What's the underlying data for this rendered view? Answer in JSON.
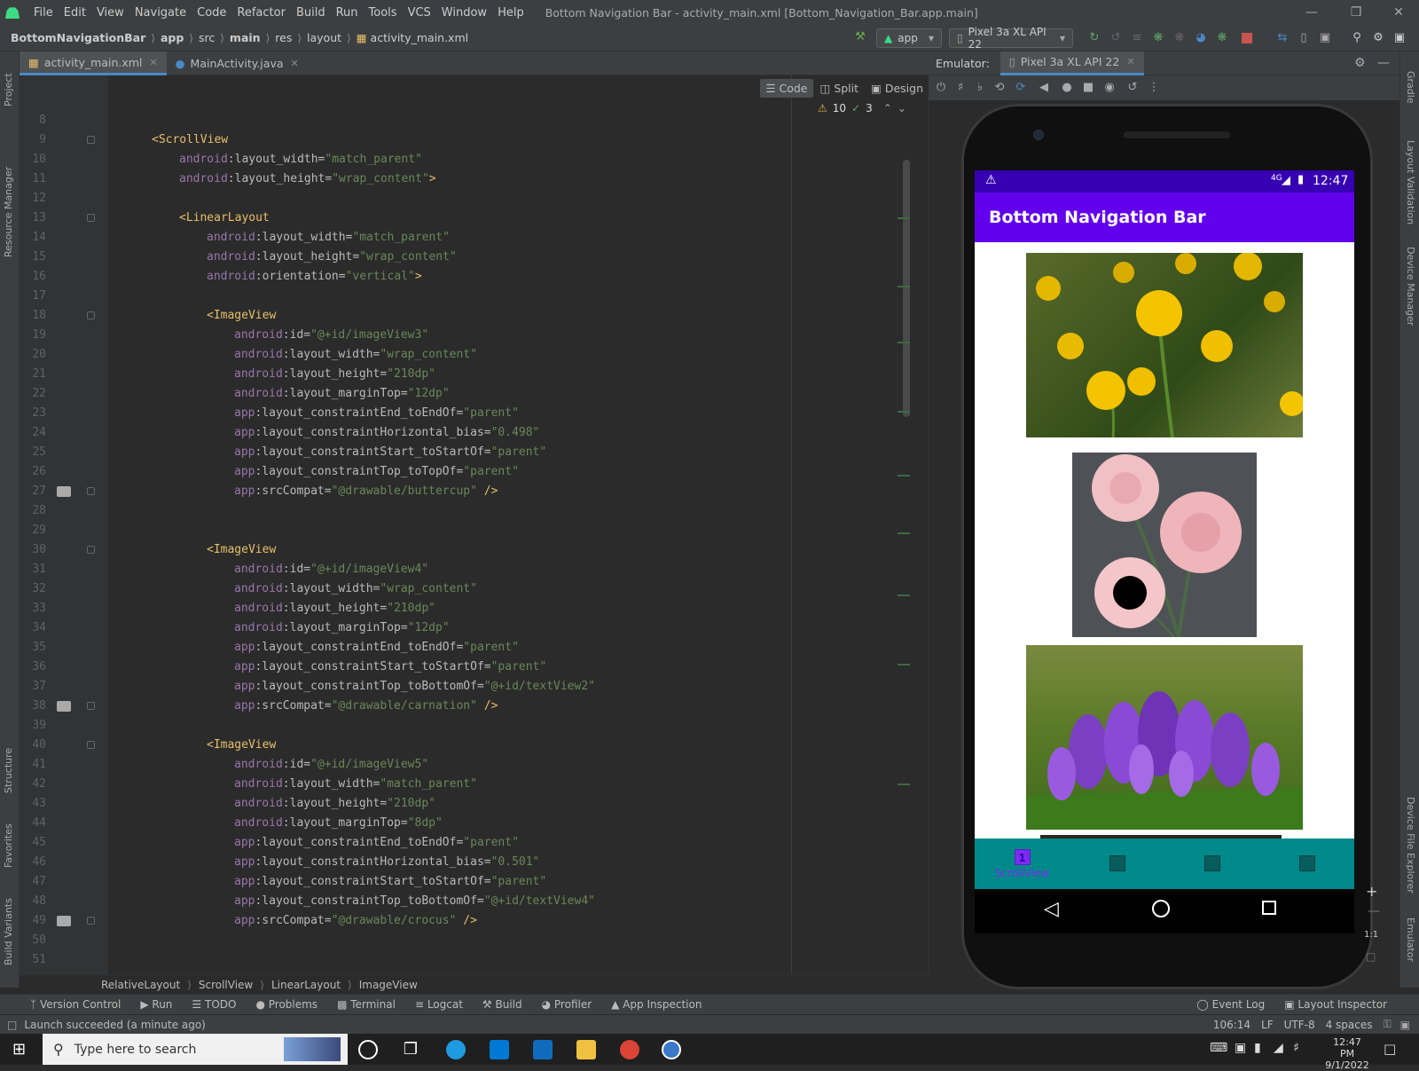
{
  "menubar": {
    "items": [
      "File",
      "Edit",
      "View",
      "Navigate",
      "Code",
      "Refactor",
      "Build",
      "Run",
      "Tools",
      "VCS",
      "Window",
      "Help"
    ],
    "title": "Bottom Navigation Bar - activity_main.xml [Bottom_Navigation_Bar.app.main]"
  },
  "navbar": {
    "breadcrumbs": [
      "BottomNavigationBar",
      "app",
      "src",
      "main",
      "res",
      "layout",
      "activity_main.xml"
    ],
    "run_config": "app",
    "device": "Pixel 3a XL API 22"
  },
  "left_tools": [
    "Project",
    "Resource Manager",
    "Structure",
    "Favorites",
    "Build Variants"
  ],
  "right_tools": [
    "Gradle",
    "Layout Validation",
    "Device Manager",
    "Device File Explorer",
    "Emulator"
  ],
  "tabs": [
    {
      "label": "activity_main.xml",
      "active": true
    },
    {
      "label": "MainActivity.java",
      "active": false
    }
  ],
  "editor_modes": [
    "Code",
    "Split",
    "Design"
  ],
  "inspections": {
    "warnings": "10",
    "ok": "3"
  },
  "code_lines": [
    {
      "n": "8",
      "i": 0,
      "t": []
    },
    {
      "n": "9",
      "i": 1,
      "t": [
        [
          "tag",
          "<ScrollView"
        ]
      ]
    },
    {
      "n": "10",
      "i": 2,
      "t": [
        [
          "ns",
          "android"
        ],
        [
          "attr",
          ":layout_width="
        ],
        [
          "str",
          "\"match_parent\""
        ]
      ]
    },
    {
      "n": "11",
      "i": 2,
      "t": [
        [
          "ns",
          "android"
        ],
        [
          "attr",
          ":layout_height="
        ],
        [
          "str",
          "\"wrap_content\""
        ],
        [
          "tag",
          ">"
        ]
      ]
    },
    {
      "n": "12",
      "i": 0,
      "t": []
    },
    {
      "n": "13",
      "i": 2,
      "t": [
        [
          "tag",
          "<LinearLayout"
        ]
      ]
    },
    {
      "n": "14",
      "i": 3,
      "t": [
        [
          "ns",
          "android"
        ],
        [
          "attr",
          ":layout_width="
        ],
        [
          "str",
          "\"match_parent\""
        ]
      ]
    },
    {
      "n": "15",
      "i": 3,
      "t": [
        [
          "ns",
          "android"
        ],
        [
          "attr",
          ":layout_height="
        ],
        [
          "str",
          "\"wrap_content\""
        ]
      ]
    },
    {
      "n": "16",
      "i": 3,
      "t": [
        [
          "ns",
          "android"
        ],
        [
          "attr",
          ":orientation="
        ],
        [
          "str",
          "\"vertical\""
        ],
        [
          "tag",
          ">"
        ]
      ]
    },
    {
      "n": "17",
      "i": 0,
      "t": []
    },
    {
      "n": "18",
      "i": 3,
      "t": [
        [
          "tag",
          "<ImageView"
        ]
      ]
    },
    {
      "n": "19",
      "i": 4,
      "t": [
        [
          "ns",
          "android"
        ],
        [
          "attr",
          ":id="
        ],
        [
          "str",
          "\"@+id/imageView3\""
        ]
      ]
    },
    {
      "n": "20",
      "i": 4,
      "t": [
        [
          "ns",
          "android"
        ],
        [
          "attr",
          ":layout_width="
        ],
        [
          "str",
          "\"wrap_content\""
        ]
      ]
    },
    {
      "n": "21",
      "i": 4,
      "t": [
        [
          "ns",
          "android"
        ],
        [
          "attr",
          ":layout_height="
        ],
        [
          "str",
          "\"210dp\""
        ]
      ]
    },
    {
      "n": "22",
      "i": 4,
      "t": [
        [
          "ns",
          "android"
        ],
        [
          "attr",
          ":layout_marginTop="
        ],
        [
          "str",
          "\"12dp\""
        ]
      ]
    },
    {
      "n": "23",
      "i": 4,
      "t": [
        [
          "ns",
          "app"
        ],
        [
          "attr",
          ":layout_constraintEnd_toEndOf="
        ],
        [
          "str",
          "\"parent\""
        ]
      ]
    },
    {
      "n": "24",
      "i": 4,
      "t": [
        [
          "ns",
          "app"
        ],
        [
          "attr",
          ":layout_constraintHorizontal_bias="
        ],
        [
          "str",
          "\"0.498\""
        ]
      ]
    },
    {
      "n": "25",
      "i": 4,
      "t": [
        [
          "ns",
          "app"
        ],
        [
          "attr",
          ":layout_constraintStart_toStartOf="
        ],
        [
          "str",
          "\"parent\""
        ]
      ]
    },
    {
      "n": "26",
      "i": 4,
      "t": [
        [
          "ns",
          "app"
        ],
        [
          "attr",
          ":layout_constraintTop_toTopOf="
        ],
        [
          "str",
          "\"parent\""
        ]
      ]
    },
    {
      "n": "27",
      "i": 4,
      "t": [
        [
          "ns",
          "app"
        ],
        [
          "attr",
          ":srcCompat="
        ],
        [
          "str",
          "\"@drawable/buttercup\""
        ],
        [
          "tag",
          " />"
        ]
      ]
    },
    {
      "n": "28",
      "i": 0,
      "t": []
    },
    {
      "n": "29",
      "i": 0,
      "t": []
    },
    {
      "n": "30",
      "i": 3,
      "t": [
        [
          "tag",
          "<ImageView"
        ]
      ]
    },
    {
      "n": "31",
      "i": 4,
      "t": [
        [
          "ns",
          "android"
        ],
        [
          "attr",
          ":id="
        ],
        [
          "str",
          "\"@+id/imageView4\""
        ]
      ]
    },
    {
      "n": "32",
      "i": 4,
      "t": [
        [
          "ns",
          "android"
        ],
        [
          "attr",
          ":layout_width="
        ],
        [
          "str",
          "\"wrap_content\""
        ]
      ]
    },
    {
      "n": "33",
      "i": 4,
      "t": [
        [
          "ns",
          "android"
        ],
        [
          "attr",
          ":layout_height="
        ],
        [
          "str",
          "\"210dp\""
        ]
      ]
    },
    {
      "n": "34",
      "i": 4,
      "t": [
        [
          "ns",
          "android"
        ],
        [
          "attr",
          ":layout_marginTop="
        ],
        [
          "str",
          "\"12dp\""
        ]
      ]
    },
    {
      "n": "35",
      "i": 4,
      "t": [
        [
          "ns",
          "app"
        ],
        [
          "attr",
          ":layout_constraintEnd_toEndOf="
        ],
        [
          "str",
          "\"parent\""
        ]
      ]
    },
    {
      "n": "36",
      "i": 4,
      "t": [
        [
          "ns",
          "app"
        ],
        [
          "attr",
          ":layout_constraintStart_toStartOf="
        ],
        [
          "str",
          "\"parent\""
        ]
      ]
    },
    {
      "n": "37",
      "i": 4,
      "t": [
        [
          "ns",
          "app"
        ],
        [
          "attr",
          ":layout_constraintTop_toBottomOf="
        ],
        [
          "str",
          "\"@+id/textView2\""
        ]
      ]
    },
    {
      "n": "38",
      "i": 4,
      "t": [
        [
          "ns",
          "app"
        ],
        [
          "attr",
          ":srcCompat="
        ],
        [
          "str",
          "\"@drawable/carnation\""
        ],
        [
          "tag",
          " />"
        ]
      ]
    },
    {
      "n": "39",
      "i": 0,
      "t": []
    },
    {
      "n": "40",
      "i": 3,
      "t": [
        [
          "tag",
          "<ImageView"
        ]
      ]
    },
    {
      "n": "41",
      "i": 4,
      "t": [
        [
          "ns",
          "android"
        ],
        [
          "attr",
          ":id="
        ],
        [
          "str",
          "\"@+id/imageView5\""
        ]
      ]
    },
    {
      "n": "42",
      "i": 4,
      "t": [
        [
          "ns",
          "android"
        ],
        [
          "attr",
          ":layout_width="
        ],
        [
          "str",
          "\"match_parent\""
        ]
      ]
    },
    {
      "n": "43",
      "i": 4,
      "t": [
        [
          "ns",
          "android"
        ],
        [
          "attr",
          ":layout_height="
        ],
        [
          "str",
          "\"210dp\""
        ]
      ]
    },
    {
      "n": "44",
      "i": 4,
      "t": [
        [
          "ns",
          "android"
        ],
        [
          "attr",
          ":layout_marginTop="
        ],
        [
          "str",
          "\"8dp\""
        ]
      ]
    },
    {
      "n": "45",
      "i": 4,
      "t": [
        [
          "ns",
          "app"
        ],
        [
          "attr",
          ":layout_constraintEnd_toEndOf="
        ],
        [
          "str",
          "\"parent\""
        ]
      ]
    },
    {
      "n": "46",
      "i": 4,
      "t": [
        [
          "ns",
          "app"
        ],
        [
          "attr",
          ":layout_constraintHorizontal_bias="
        ],
        [
          "str",
          "\"0.501\""
        ]
      ]
    },
    {
      "n": "47",
      "i": 4,
      "t": [
        [
          "ns",
          "app"
        ],
        [
          "attr",
          ":layout_constraintStart_toStartOf="
        ],
        [
          "str",
          "\"parent\""
        ]
      ]
    },
    {
      "n": "48",
      "i": 4,
      "t": [
        [
          "ns",
          "app"
        ],
        [
          "attr",
          ":layout_constraintTop_toBottomOf="
        ],
        [
          "str",
          "\"@+id/textView4\""
        ]
      ]
    },
    {
      "n": "49",
      "i": 4,
      "t": [
        [
          "ns",
          "app"
        ],
        [
          "attr",
          ":srcCompat="
        ],
        [
          "str",
          "\"@drawable/crocus\""
        ],
        [
          "tag",
          " />"
        ]
      ]
    },
    {
      "n": "50",
      "i": 0,
      "t": []
    },
    {
      "n": "51",
      "i": 0,
      "t": []
    }
  ],
  "code_breadcrumbs": [
    "RelativeLayout",
    "ScrollView",
    "LinearLayout",
    "ImageView"
  ],
  "emulator": {
    "label": "Emulator:",
    "tab": "Pixel 3a XL API 22",
    "phone": {
      "time": "12:47",
      "network": "4G",
      "app_title": "Bottom Navigation Bar",
      "bottom_nav": [
        {
          "label": "ScrollView",
          "num": "1",
          "active": true
        },
        {
          "label": "",
          "num": "2",
          "active": false
        },
        {
          "label": "",
          "num": "3",
          "active": false
        },
        {
          "label": "",
          "num": "4",
          "active": false
        }
      ]
    },
    "zoom_label": "1:1"
  },
  "bottom_tools": [
    "Version Control",
    "Run",
    "TODO",
    "Problems",
    "Terminal",
    "Logcat",
    "Build",
    "Profiler",
    "App Inspection"
  ],
  "bottom_tools_right": [
    "Event Log",
    "Layout Inspector"
  ],
  "status": {
    "message": "Launch succeeded (a minute ago)",
    "position": "106:14",
    "line_sep": "LF",
    "encoding": "UTF-8",
    "indent": "4 spaces"
  },
  "taskbar": {
    "search_placeholder": "Type here to search",
    "time": "12:47 PM",
    "date": "9/1/2022"
  },
  "colors": {
    "status_bar": "#3700b3",
    "app_bar": "#6200ee",
    "bottom_nav": "#00898a"
  }
}
